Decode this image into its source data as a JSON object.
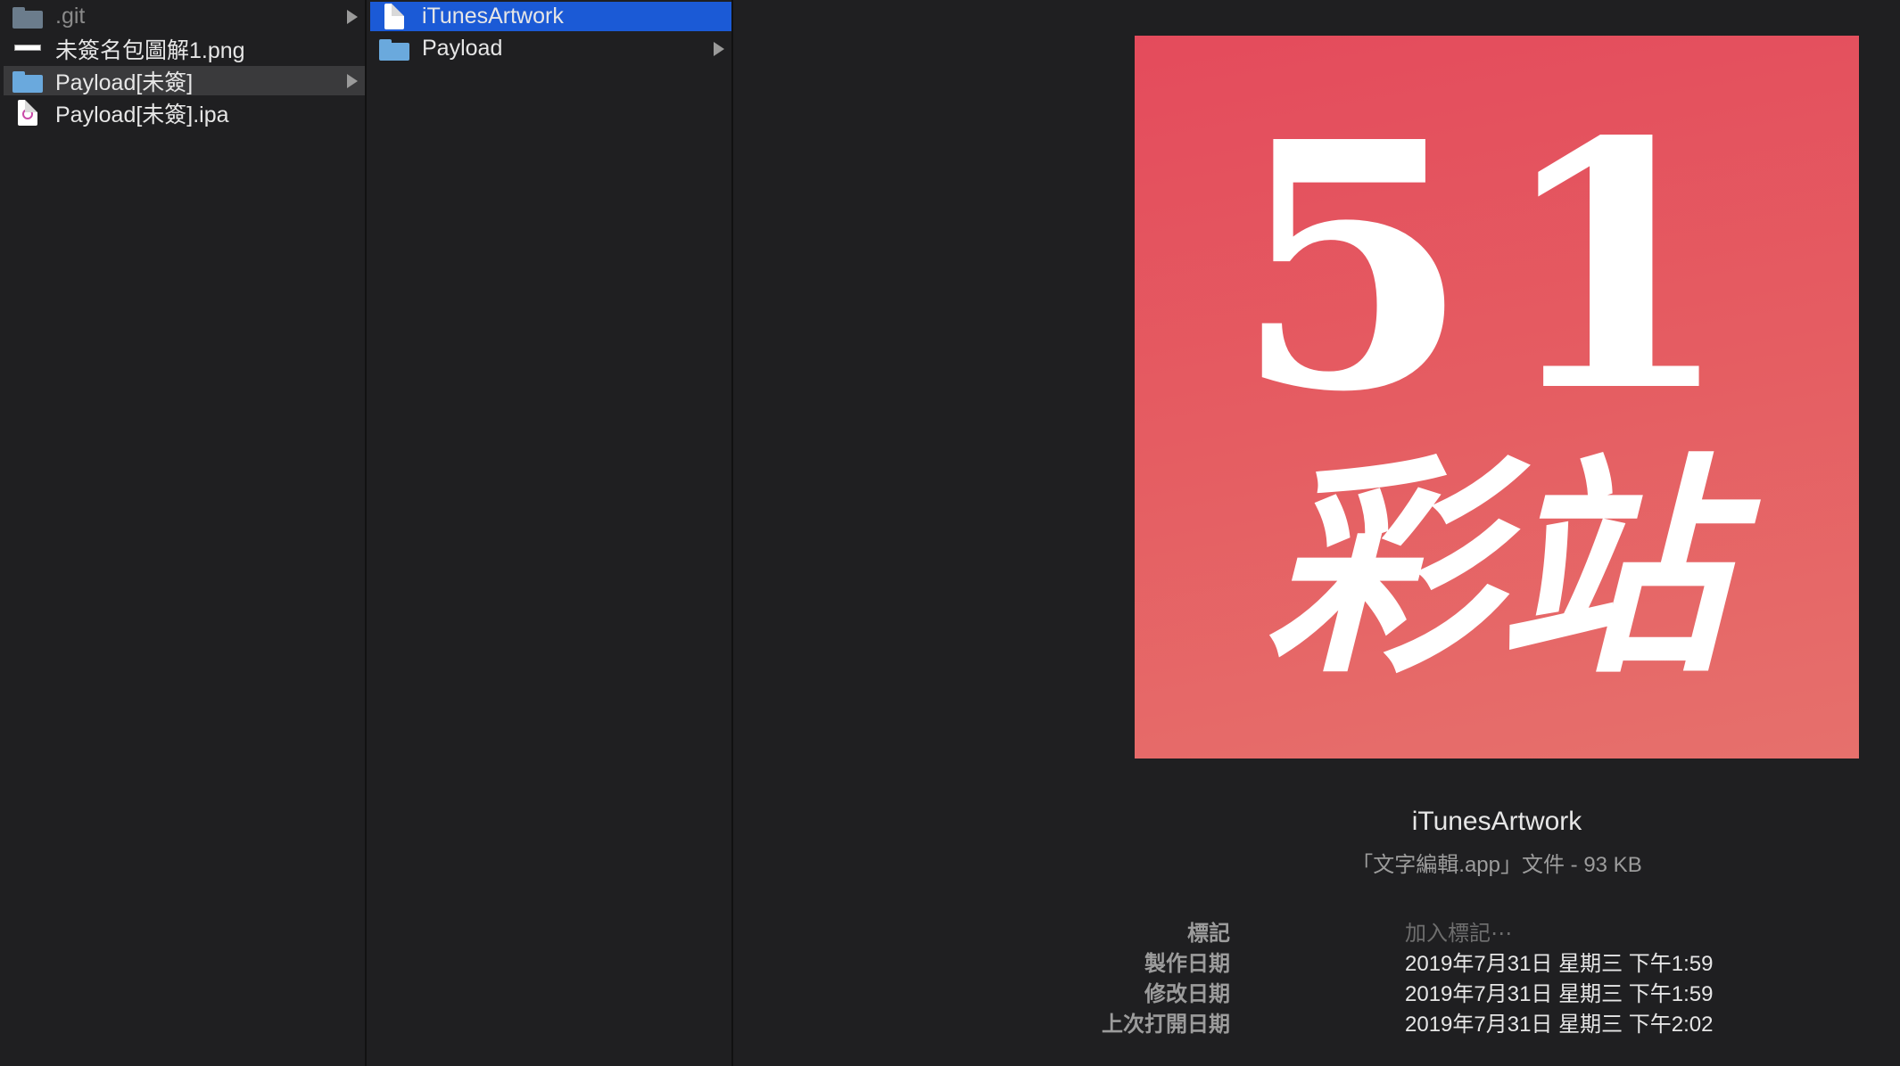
{
  "column1": {
    "items": [
      {
        "label": ".git",
        "icon": "folder-icon",
        "dim": true,
        "arrow": true
      },
      {
        "label": "未簽名包圖解1.png",
        "icon": "png-thumbnail-icon"
      },
      {
        "label": "Payload[未簽]",
        "icon": "folder-icon",
        "arrow": true,
        "selected": "grey"
      },
      {
        "label": "Payload[未簽].ipa",
        "icon": "ipa-file-icon"
      }
    ]
  },
  "column2": {
    "items": [
      {
        "label": "iTunesArtwork",
        "icon": "document-icon",
        "selected": "blue"
      },
      {
        "label": "Payload",
        "icon": "folder-icon",
        "arrow": true
      }
    ]
  },
  "preview": {
    "artwork_number": "51",
    "artwork_text": "彩站",
    "artwork_colors": {
      "top": "#e44b5c",
      "bottom": "#e6706c"
    },
    "filename": "iTunesArtwork",
    "kind": "「文字編輯.app」文件 - 93 KB",
    "meta": {
      "tags_label": "標記",
      "tags_placeholder": "加入標記⋯",
      "created_label": "製作日期",
      "created_value": "2019年7月31日 星期三 下午1:59",
      "modified_label": "修改日期",
      "modified_value": "2019年7月31日 星期三 下午1:59",
      "opened_label": "上次打開日期",
      "opened_value": "2019年7月31日 星期三 下午2:02"
    }
  },
  "colors": {
    "background": "#1f1f21",
    "selection_blue": "#1b5ad6",
    "selection_grey": "#3a3a3c",
    "folder_blue": "#6aa9dd"
  }
}
